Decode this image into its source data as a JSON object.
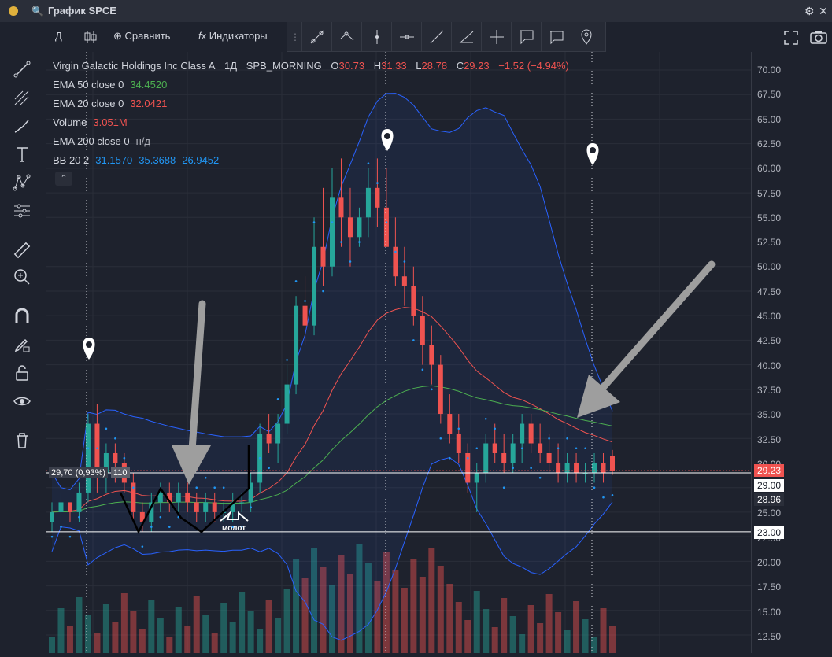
{
  "window": {
    "title": "График SPCE"
  },
  "topbar": {
    "interval": "Д",
    "compare": "Сравнить",
    "indicators": "Индикаторы"
  },
  "legend": {
    "symbol": "Virgin Galactic Holdings Inc Class A",
    "interval": "1Д",
    "session": "SPB_MORNING",
    "o_label": "O",
    "o": "30.73",
    "h_label": "H",
    "h": "31.33",
    "l_label": "L",
    "l": "28.78",
    "c_label": "C",
    "c": "29.23",
    "change": "−1.52 (−4.94%)",
    "ema50_label": "EMA 50 close 0",
    "ema50": "34.4520",
    "ema20_label": "EMA 20 close 0",
    "ema20": "32.0421",
    "volume_label": "Volume",
    "volume": "3.051M",
    "ema200_label": "EMA 200 close 0",
    "ema200": "н/д",
    "bb_label": "BB 20 2",
    "bb1": "31.1570",
    "bb2": "35.3688",
    "bb3": "26.9452"
  },
  "price_axis": {
    "ticks": [
      "70.00",
      "67.50",
      "65.00",
      "62.50",
      "60.00",
      "57.50",
      "55.00",
      "52.50",
      "50.00",
      "47.50",
      "45.00",
      "42.50",
      "40.00",
      "37.50",
      "35.00",
      "32.50",
      "30.00",
      "27.50",
      "25.00",
      "22.50",
      "20.00",
      "17.50",
      "15.00",
      "12.50"
    ]
  },
  "price_tags": {
    "last": "29.23",
    "level1": "29.00",
    "lower": "28.96",
    "level2": "23.00"
  },
  "line_info": {
    "label": "29,70 (0,93%)",
    "bars": "110"
  },
  "annotation": {
    "hammer": "молот"
  },
  "chart_data": {
    "type": "candlestick",
    "ylim": [
      11,
      72
    ],
    "candles": [
      [
        24,
        26,
        23,
        25
      ],
      [
        25,
        27,
        24,
        26
      ],
      [
        26,
        26,
        24,
        25
      ],
      [
        25,
        28,
        24,
        27
      ],
      [
        27,
        35,
        26,
        34
      ],
      [
        34,
        36,
        27,
        29
      ],
      [
        29,
        32,
        27,
        31
      ],
      [
        31,
        32,
        28,
        30
      ],
      [
        30,
        31,
        27,
        28
      ],
      [
        28,
        29,
        24,
        25
      ],
      [
        25,
        26,
        23,
        24
      ],
      [
        24,
        27,
        23,
        26
      ],
      [
        26,
        28,
        25,
        27
      ],
      [
        27,
        28,
        25,
        26
      ],
      [
        26,
        28,
        25,
        27
      ],
      [
        27,
        28,
        25,
        26
      ],
      [
        26,
        27,
        24,
        25
      ],
      [
        25,
        27,
        24,
        26
      ],
      [
        26,
        27,
        24,
        25
      ],
      [
        25,
        26,
        24,
        25
      ],
      [
        25,
        27,
        24,
        26
      ],
      [
        26,
        27,
        25,
        26
      ],
      [
        26,
        29,
        25,
        28
      ],
      [
        28,
        34,
        27,
        33
      ],
      [
        33,
        35,
        31,
        32
      ],
      [
        32,
        35,
        30,
        34
      ],
      [
        34,
        40,
        33,
        38
      ],
      [
        38,
        47,
        37,
        46
      ],
      [
        46,
        49,
        42,
        44
      ],
      [
        44,
        55,
        43,
        52
      ],
      [
        52,
        58,
        48,
        50
      ],
      [
        50,
        60,
        49,
        57
      ],
      [
        57,
        61,
        52,
        55
      ],
      [
        55,
        58,
        50,
        53
      ],
      [
        53,
        56,
        52,
        55
      ],
      [
        55,
        60,
        53,
        58
      ],
      [
        58,
        61,
        54,
        56
      ],
      [
        56,
        60,
        53,
        52
      ],
      [
        52,
        55,
        48,
        49
      ],
      [
        49,
        52,
        46,
        48
      ],
      [
        48,
        50,
        44,
        45
      ],
      [
        45,
        47,
        40,
        42
      ],
      [
        42,
        44,
        38,
        40
      ],
      [
        40,
        41,
        34,
        35
      ],
      [
        35,
        37,
        32,
        33
      ],
      [
        33,
        35,
        30,
        31
      ],
      [
        31,
        32,
        27,
        28
      ],
      [
        28,
        30,
        25,
        29
      ],
      [
        29,
        33,
        28,
        32
      ],
      [
        32,
        34,
        30,
        31
      ],
      [
        31,
        33,
        29,
        30
      ],
      [
        30,
        33,
        29,
        32
      ],
      [
        32,
        35,
        30,
        34
      ],
      [
        34,
        35,
        31,
        32
      ],
      [
        32,
        34,
        30,
        31
      ],
      [
        31,
        33,
        29,
        30
      ],
      [
        30,
        32,
        28,
        29
      ],
      [
        29,
        31,
        28,
        30
      ],
      [
        30,
        31,
        28,
        29
      ],
      [
        29,
        30,
        28,
        29
      ],
      [
        29,
        31,
        28,
        30
      ],
      [
        30,
        31,
        28,
        29
      ],
      [
        30.73,
        31.33,
        28.78,
        29.23
      ]
    ],
    "volume_max": 3.051
  },
  "colors": {
    "up": "#26a69a",
    "down": "#ef5350",
    "ema20": "#ef5350",
    "ema50": "#4caf50",
    "bb": "#2962ff",
    "psar": "#2196f3"
  },
  "icons": [
    "settings-icon",
    "search-icon",
    "fullscreen-icon",
    "camera-icon",
    "crosshair-icon",
    "trend-line-icon",
    "pitchfork-icon",
    "brush-icon",
    "text-icon",
    "pattern-icon",
    "forecast-icon",
    "ruler-icon",
    "zoom-icon",
    "magnet-icon",
    "lock-draw-icon",
    "lock-icon",
    "eye-icon",
    "trash-icon"
  ]
}
